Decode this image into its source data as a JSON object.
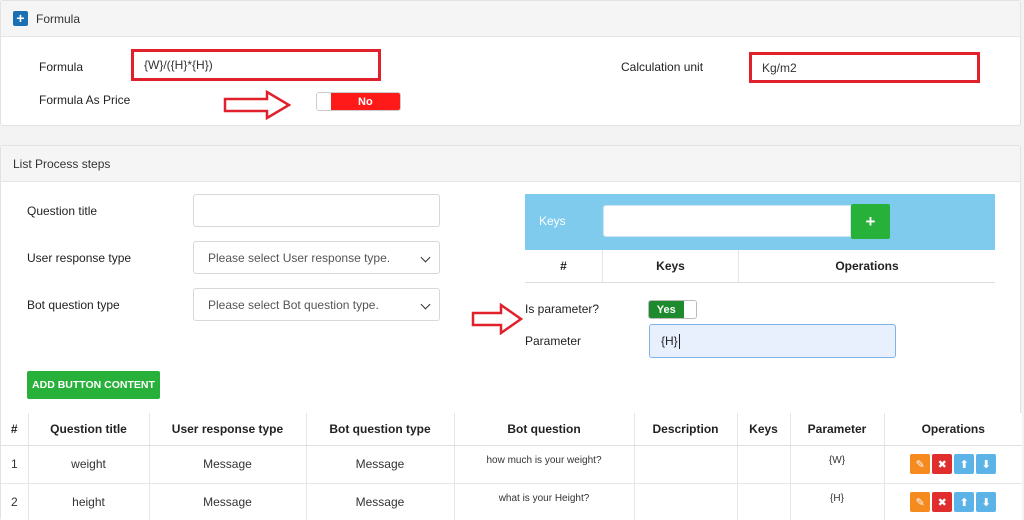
{
  "formula_panel": {
    "title": "Formula",
    "formula_label": "Formula",
    "formula_value": "{W}/({H}*{H})",
    "unit_label": "Calculation unit",
    "unit_value": "Kg/m2",
    "as_price_label": "Formula As Price",
    "as_price_toggle": "No"
  },
  "steps_panel": {
    "title": "List Process steps",
    "question_title_label": "Question title",
    "question_title_value": "",
    "user_response_label": "User response type",
    "user_response_placeholder": "Please select User response type.",
    "bot_question_label": "Bot question type",
    "bot_question_placeholder": "Please select Bot question type.",
    "add_button_label": "ADD BUTTON CONTENT",
    "keys_label": "Keys",
    "keys_add": "+",
    "keys_table_headers": [
      "#",
      "Keys",
      "Operations"
    ],
    "is_parameter_label": "Is parameter?",
    "is_parameter_toggle": "Yes",
    "parameter_label": "Parameter",
    "parameter_value": "{H}"
  },
  "table": {
    "headers": [
      "#",
      "Question title",
      "User response type",
      "Bot question type",
      "Bot question",
      "Description",
      "Keys",
      "Parameter",
      "Operations"
    ],
    "rows": [
      {
        "num": "1",
        "title": "weight",
        "user_response": "Message",
        "bot_type": "Message",
        "bot_question": "how much is your weight?",
        "description": "",
        "keys": "",
        "parameter": "{W}"
      },
      {
        "num": "2",
        "title": "height",
        "user_response": "Message",
        "bot_type": "Message",
        "bot_question": "what is your Height?",
        "description": "",
        "keys": "",
        "parameter": "{H}"
      }
    ]
  },
  "colors": {
    "highlight": "#e0202b",
    "toggle_no": "#ff1a1a",
    "toggle_yes": "#1e8a2e",
    "keys_box": "#7ecbee",
    "add_button": "#27b13a"
  },
  "icons": [
    "plus-icon",
    "pencil-icon",
    "close-icon",
    "arrow-up-icon",
    "arrow-down-icon",
    "chevron-down-icon"
  ]
}
